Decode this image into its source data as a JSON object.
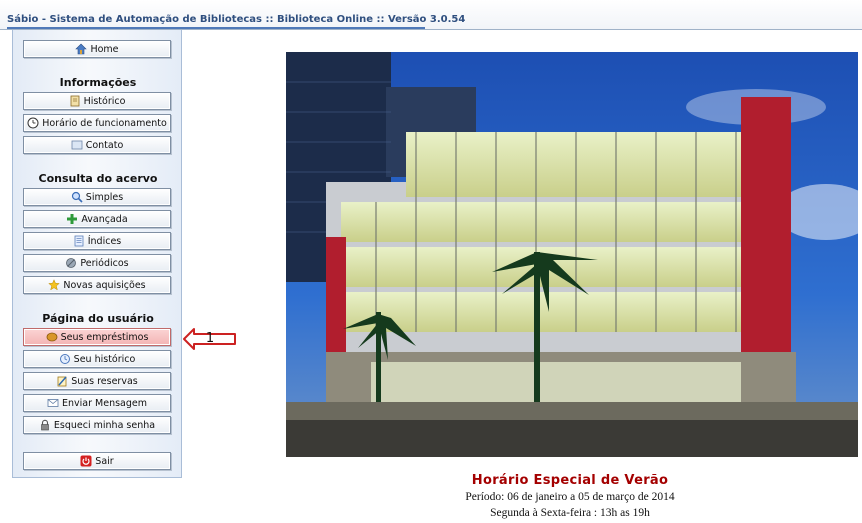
{
  "window": {
    "title": "Sábio - Sistema de Automação de Bibliotecas :: Biblioteca Online :: Versão 3.0.54"
  },
  "sidebar": {
    "home": {
      "label": "Home"
    },
    "sections": [
      {
        "heading": "Informações",
        "items": [
          {
            "label": "Histórico",
            "icon": "history-icon"
          },
          {
            "label": "Horário de funcionamento",
            "icon": "clock-icon"
          },
          {
            "label": "Contato",
            "icon": "contact-icon"
          }
        ]
      },
      {
        "heading": "Consulta do acervo",
        "items": [
          {
            "label": "Simples",
            "icon": "search-icon"
          },
          {
            "label": "Avançada",
            "icon": "advanced-search-icon"
          },
          {
            "label": "Índices",
            "icon": "index-icon"
          },
          {
            "label": "Periódicos",
            "icon": "periodicals-icon"
          },
          {
            "label": "Novas aquisições",
            "icon": "star-icon"
          }
        ]
      },
      {
        "heading": "Página do usuário",
        "items": [
          {
            "label": "Seus empréstimos",
            "icon": "loans-icon",
            "highlighted": true
          },
          {
            "label": "Seu histórico",
            "icon": "user-history-icon"
          },
          {
            "label": "Suas reservas",
            "icon": "reservations-icon"
          },
          {
            "label": "Enviar Mensagem",
            "icon": "mail-icon"
          },
          {
            "label": "Esqueci minha senha",
            "icon": "lock-icon"
          }
        ]
      }
    ],
    "exit": {
      "label": "Sair"
    }
  },
  "callout": {
    "number": "1"
  },
  "main": {
    "heading": "Horário Especial de Verão",
    "period": "Período: 06 de janeiro a 05 de março de 2014",
    "hours": "Segunda à Sexta-feira : 13h as 19h"
  },
  "colors": {
    "heading_red": "#a40000",
    "highlight_pink": "#f3b4b4",
    "title_blue": "#2f4f7f",
    "callout_red": "#cc2222"
  }
}
